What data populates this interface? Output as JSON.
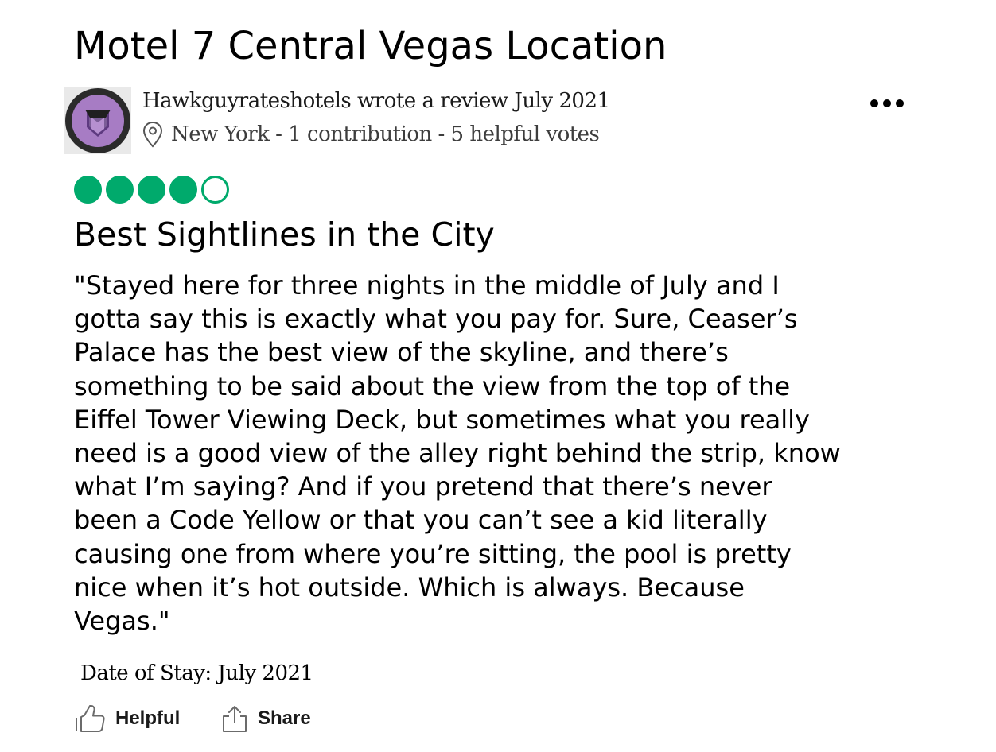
{
  "page": {
    "title": "Motel 7 Central Vegas Location"
  },
  "review": {
    "reviewer_line": "Hawkguyrateshotels wrote a review July 2021",
    "reviewer_meta": "New York - 1 contribution - 5 helpful votes",
    "rating": {
      "value": 4,
      "max": 5,
      "color": "#00aa6c"
    },
    "title": "Best Sightlines in the City",
    "body": "\"Stayed here for three nights in the middle of July and I\ngotta say this is exactly what you pay for. Sure, Ceaser’s\nPalace has the best view of the skyline, and there’s\nsomething to be said about the view from the top of the\nEiffel Tower Viewing Deck, but sometimes what you really\nneed is a good view of the alley right behind the strip, know\nwhat I’m saying? And if you pretend that there’s never\nbeen a Code Yellow or that you can’t see a kid literally\ncausing one from where you’re sitting, the pool is pretty\nnice when it’s hot outside. Which is always. Because\nVegas.\"",
    "date_of_stay": "Date of Stay: July 2021"
  },
  "actions": {
    "helpful_label": "Helpful",
    "share_label": "Share"
  },
  "icons": {
    "avatar": "hawkeye-avatar",
    "location": "location-pin-icon",
    "more": "more-options-icon",
    "helpful": "thumbs-up-icon",
    "share": "share-icon"
  },
  "colors": {
    "rating_bubble": "#00aa6c",
    "avatar_purple": "#a77cc4",
    "avatar_ring": "#2b2b2b"
  }
}
